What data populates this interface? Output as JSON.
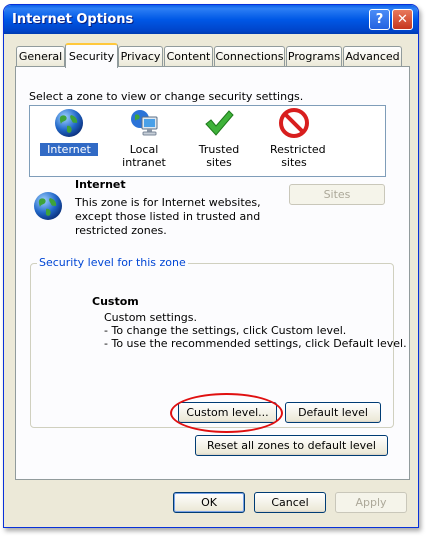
{
  "window": {
    "title": "Internet Options",
    "help_button": "?",
    "close_button": "✕"
  },
  "tabs": [
    {
      "label": "General",
      "active": false
    },
    {
      "label": "Security",
      "active": true
    },
    {
      "label": "Privacy",
      "active": false
    },
    {
      "label": "Content",
      "active": false
    },
    {
      "label": "Connections",
      "active": false
    },
    {
      "label": "Programs",
      "active": false
    },
    {
      "label": "Advanced",
      "active": false
    }
  ],
  "security": {
    "instruction": "Select a zone to view or change security settings.",
    "zones": [
      {
        "label": "Internet",
        "icon": "globe-icon",
        "selected": true
      },
      {
        "label": "Local intranet",
        "icon": "computer-globe-icon",
        "selected": false
      },
      {
        "label": "Trusted sites",
        "icon": "checkmark-icon",
        "selected": false
      },
      {
        "label": "Restricted sites",
        "icon": "restricted-icon",
        "selected": false
      }
    ],
    "zone_info": {
      "name": "Internet",
      "description_lines": [
        "This zone is for Internet websites,",
        "except those listed in trusted and",
        "restricted zones."
      ],
      "sites_button": "Sites",
      "sites_enabled": false
    },
    "level": {
      "group_title": "Security level for this zone",
      "heading": "Custom",
      "lines": [
        "Custom settings.",
        "- To change the settings, click Custom level.",
        "- To use the recommended settings, click Default level."
      ],
      "custom_level_button": "Custom level...",
      "default_level_button": "Default level"
    },
    "reset_all_button": "Reset all zones to default level"
  },
  "footer": {
    "ok": "OK",
    "cancel": "Cancel",
    "apply": "Apply",
    "apply_enabled": false
  },
  "colors": {
    "titlebar": "#0058e6",
    "dialog_bg": "#ece9d8",
    "selection": "#316ac5",
    "group_title": "#0046d5",
    "highlight": "#e01010"
  }
}
